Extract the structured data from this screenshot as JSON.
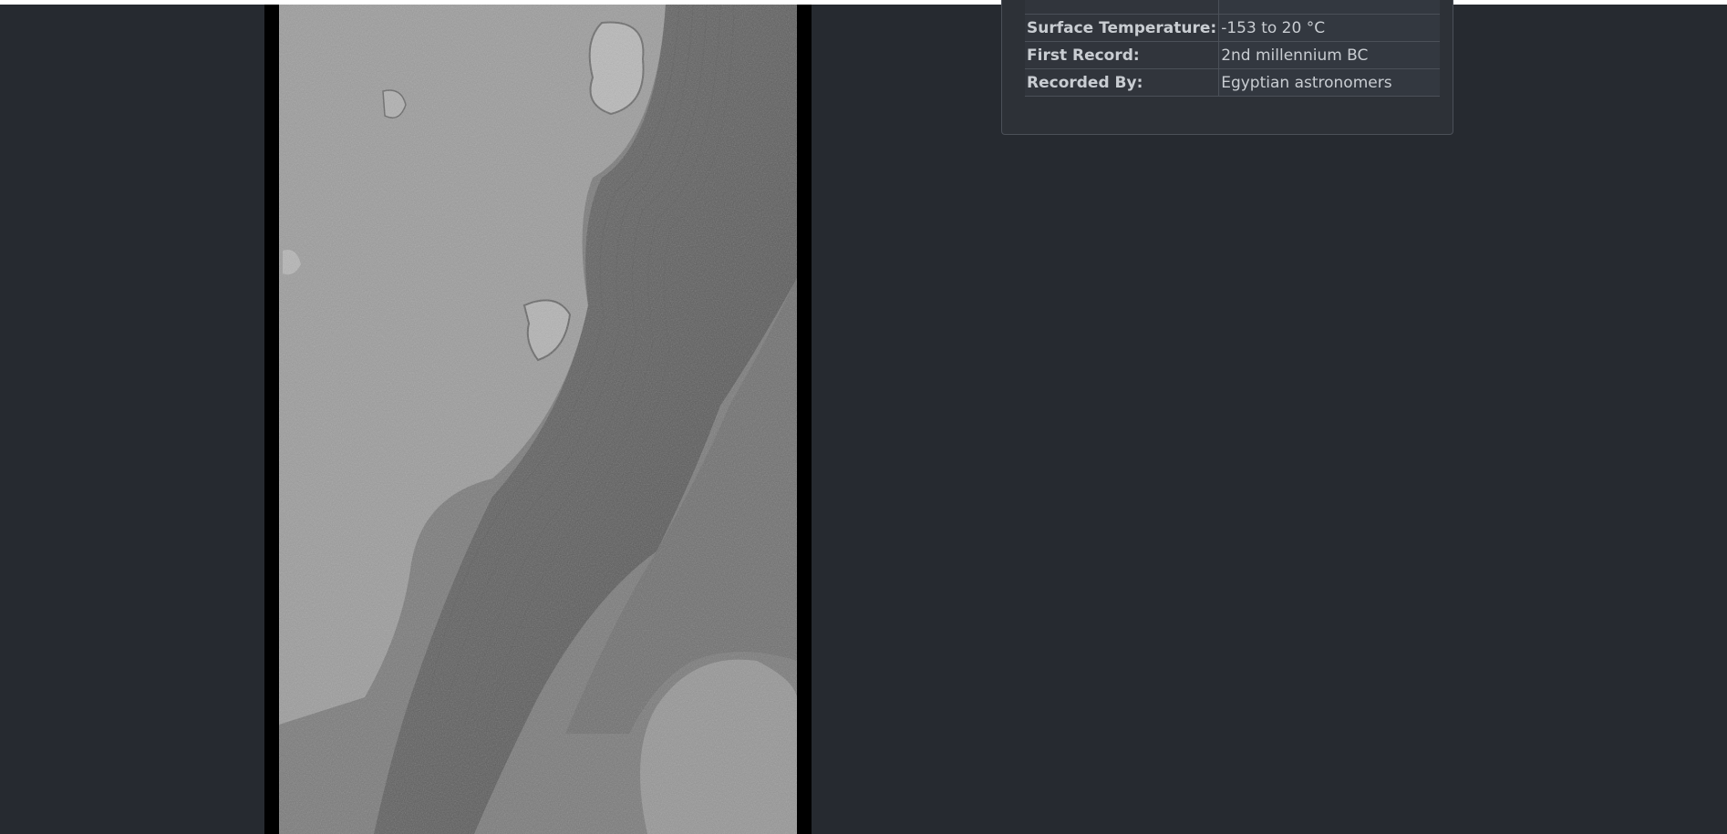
{
  "info_table": {
    "rows": [
      {
        "label": "",
        "value": ""
      },
      {
        "label": "Surface Temperature:",
        "value": "-153 to 20 °C"
      },
      {
        "label": "First Record:",
        "value": "2nd millennium BC"
      },
      {
        "label": "Recorded By:",
        "value": "Egyptian astronomers"
      }
    ]
  },
  "image": {
    "subject": "grayscale orbital surface image"
  },
  "colors": {
    "background": "#262a30",
    "card": "#2d3137",
    "card_border": "#4b5058",
    "text": "#c9cdd2"
  }
}
